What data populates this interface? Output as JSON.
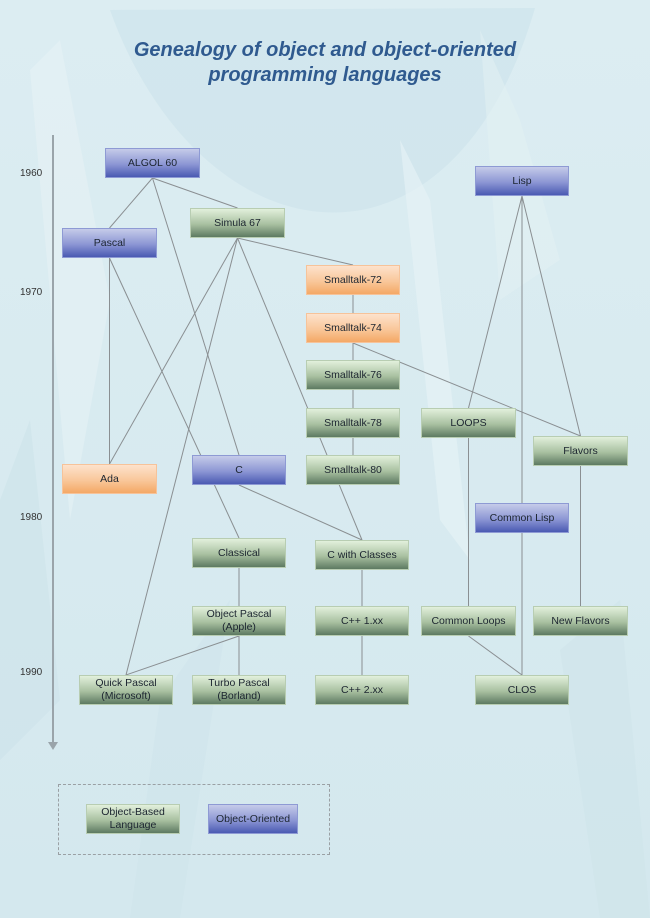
{
  "title": {
    "line1": "Genealogy of object and object-oriented",
    "line2": "programming languages"
  },
  "colors": {
    "title": "#2f5a8f",
    "object_oriented": "#5a67bb",
    "object_based": "#6f8a72",
    "highlight": "#f6b27a",
    "edge": "#8a8f92"
  },
  "timeline": {
    "years": [
      "1960",
      "1970",
      "1980",
      "1990"
    ]
  },
  "nodes": [
    {
      "id": "algol60",
      "label": "ALGOL 60",
      "type": "blue"
    },
    {
      "id": "pascal",
      "label": "Pascal",
      "type": "blue"
    },
    {
      "id": "simula67",
      "label": "Simula 67",
      "type": "green"
    },
    {
      "id": "smalltalk72",
      "label": "Smalltalk-72",
      "type": "orange"
    },
    {
      "id": "smalltalk74",
      "label": "Smalltalk-74",
      "type": "orange"
    },
    {
      "id": "smalltalk76",
      "label": "Smalltalk-76",
      "type": "green"
    },
    {
      "id": "smalltalk78",
      "label": "Smalltalk-78",
      "type": "green"
    },
    {
      "id": "smalltalk80",
      "label": "Smalltalk-80",
      "type": "green"
    },
    {
      "id": "ada",
      "label": "Ada",
      "type": "orange"
    },
    {
      "id": "c",
      "label": "C",
      "type": "blue"
    },
    {
      "id": "classical",
      "label": "Classical",
      "type": "green"
    },
    {
      "id": "cwithclasses",
      "label": "C with Classes",
      "type": "green"
    },
    {
      "id": "objectpascal",
      "label": "Object Pascal\n(Apple)",
      "type": "green"
    },
    {
      "id": "cpp1",
      "label": "C++ 1.xx",
      "type": "green"
    },
    {
      "id": "quickpascal",
      "label": "Quick Pascal\n(Microsoft)",
      "type": "green"
    },
    {
      "id": "turbopascal",
      "label": "Turbo Pascal\n(Borland)",
      "type": "green"
    },
    {
      "id": "cpp2",
      "label": "C++ 2.xx",
      "type": "green"
    },
    {
      "id": "lisp",
      "label": "Lisp",
      "type": "blue"
    },
    {
      "id": "loops",
      "label": "LOOPS",
      "type": "green"
    },
    {
      "id": "flavors",
      "label": "Flavors",
      "type": "green"
    },
    {
      "id": "commonlisp",
      "label": "Common Lisp",
      "type": "blue"
    },
    {
      "id": "commonloops",
      "label": "Common Loops",
      "type": "green"
    },
    {
      "id": "newflavors",
      "label": "New Flavors",
      "type": "green"
    },
    {
      "id": "clos",
      "label": "CLOS",
      "type": "green"
    }
  ],
  "edges": [
    [
      "algol60",
      "pascal"
    ],
    [
      "algol60",
      "simula67"
    ],
    [
      "algol60",
      "c"
    ],
    [
      "pascal",
      "ada"
    ],
    [
      "pascal",
      "classical"
    ],
    [
      "simula67",
      "smalltalk72"
    ],
    [
      "simula67",
      "ada"
    ],
    [
      "simula67",
      "quickpascal"
    ],
    [
      "simula67",
      "cwithclasses"
    ],
    [
      "smalltalk72",
      "smalltalk74"
    ],
    [
      "smalltalk74",
      "smalltalk76"
    ],
    [
      "smalltalk74",
      "flavors"
    ],
    [
      "smalltalk76",
      "smalltalk78"
    ],
    [
      "smalltalk78",
      "smalltalk80"
    ],
    [
      "c",
      "cwithclasses"
    ],
    [
      "classical",
      "objectpascal"
    ],
    [
      "objectpascal",
      "quickpascal"
    ],
    [
      "objectpascal",
      "turbopascal"
    ],
    [
      "cwithclasses",
      "cpp1"
    ],
    [
      "cpp1",
      "cpp2"
    ],
    [
      "lisp",
      "loops"
    ],
    [
      "lisp",
      "flavors"
    ],
    [
      "lisp",
      "clos"
    ],
    [
      "loops",
      "commonloops"
    ],
    [
      "flavors",
      "newflavors"
    ],
    [
      "commonloops",
      "clos"
    ]
  ],
  "legend": {
    "object_based": "Object-Based\nLanguage",
    "object_oriented": "Object-Oriented"
  }
}
